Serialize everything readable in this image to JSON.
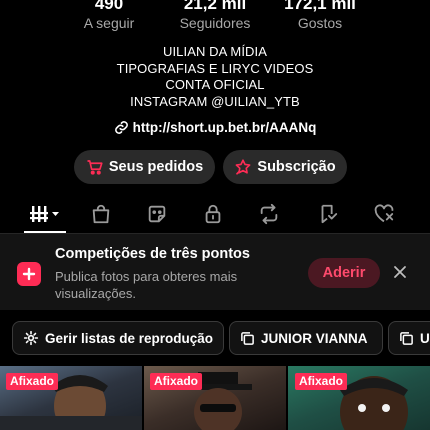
{
  "stats": [
    {
      "value": "490",
      "label": "A seguir"
    },
    {
      "value": "21,2 mil",
      "label": "Seguidores"
    },
    {
      "value": "172,1 mil",
      "label": "Gostos"
    }
  ],
  "bio": {
    "lines": [
      "UILIAN DA MÍDIA",
      "TIPOGRAFIAS E LIRYC VIDEOS",
      "CONTA OFICIAL",
      "INSTAGRAM @UILIAN_YTB"
    ],
    "link": "http://short.up.bet.br/AAANq",
    "link_icon": "link-icon"
  },
  "actions": {
    "orders": {
      "label": "Seus pedidos",
      "icon": "cart-icon"
    },
    "subscription": {
      "label": "Subscrição",
      "icon": "star-icon"
    }
  },
  "tabs": [
    {
      "icon": "grid-icon",
      "selected": true
    },
    {
      "icon": "shopping-bag-icon"
    },
    {
      "icon": "sticker-icon"
    },
    {
      "icon": "lock-icon"
    },
    {
      "icon": "repost-icon"
    },
    {
      "icon": "bookmark-icon"
    },
    {
      "icon": "liked-icon"
    }
  ],
  "promo": {
    "title": "Competições de três pontos",
    "subtitle": "Publica fotos para obteres mais visualizações.",
    "join_label": "Aderir",
    "accent": "#fe2c55"
  },
  "playlists": [
    {
      "label": "Gerir listas de reprodução",
      "icon": "gear-icon"
    },
    {
      "label": "JUNIOR VIANNA",
      "icon": "playlist-icon"
    },
    {
      "label": "U",
      "icon": "playlist-icon"
    }
  ],
  "videos": [
    {
      "badge": "Afixado"
    },
    {
      "badge": "Afixado"
    },
    {
      "badge": "Afixado"
    }
  ]
}
